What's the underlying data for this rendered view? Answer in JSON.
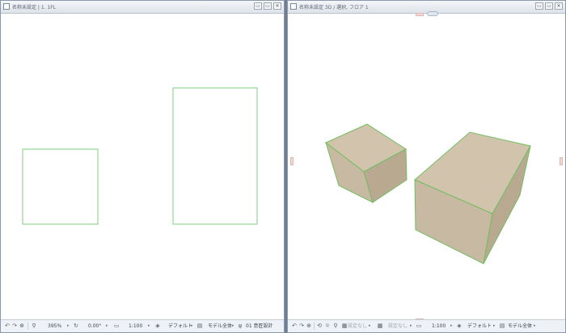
{
  "left_window": {
    "title": "名称未設定 | 1. 1FL",
    "buttons": [
      "▭",
      "▭",
      "✕"
    ],
    "status": {
      "zoom": "395%",
      "angle": "0.00°",
      "scale": "1:100",
      "layer_combo": "デフォルト",
      "model_view": "モデル全体",
      "renovation": "01 意匠設計"
    }
  },
  "right_window": {
    "title": "名称未設定 3D / 選択, フロア 1",
    "buttons": [
      "▭",
      "▭",
      "✕"
    ],
    "status": {
      "filter1": "設定なし",
      "filter2": "設定なし",
      "scale": "1:100",
      "layer_combo": "デフォルト",
      "model_view": "モデル全体"
    }
  },
  "colors": {
    "outline_green": "#7fcf7f",
    "box_top": "#d2c3ac",
    "box_left": "#c8b9a2",
    "box_right": "#baa991",
    "box_edge": "#6fbf5f"
  }
}
